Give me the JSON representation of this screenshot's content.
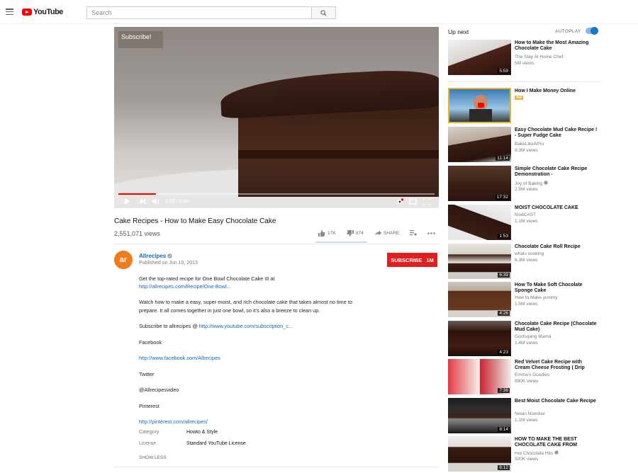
{
  "masthead": {
    "logo_text": "YouTube",
    "search_placeholder": "Search"
  },
  "player": {
    "overlay_text": "Subscribe!",
    "time": "0:20 / 2:48",
    "progress_fraction": 0.119
  },
  "video": {
    "title": "Cake Recipes - How to Make Easy Chocolate Cake",
    "views": "2,551,071 views",
    "likes": "17K",
    "dislikes": "874",
    "share_label": "SHARE"
  },
  "channel": {
    "avatar_text": "ar",
    "name": "Allrecipes",
    "published": "Published on Jun 10, 2013",
    "subscribe_label": "SUBSCRIBE",
    "subscriber_count": "1M"
  },
  "description": {
    "line1": "Get the top-rated recipe for One Bowl Chocolate Cake III at",
    "link1": "http://allrecipes.com/Recipe/One-Bowl...",
    "line2": "Watch how to make a easy, super-moist, and rich chocolate cake that takes almost no time to",
    "line3": "prepare. It all comes together in just one bowl, so it's also a breeze to clean up.",
    "subscribe_prefix": "Subscribe to allrecipes @ ",
    "subscribe_link": "http://www.youtube.com/subscription_c...",
    "facebook_label": "Facebook",
    "facebook_link": "http://www.facebook.com/Allrecipes",
    "twitter_label": "Twitter",
    "twitter_handle": "@Allrecipesvideo",
    "pinterest_label": "Pinterest",
    "pinterest_link": "http://pinterest.com/allrecipes/",
    "category_label": "Category",
    "category_value": "Howto & Style",
    "license_label": "License",
    "license_value": "Standard YouTube License",
    "show_less": "SHOW LESS"
  },
  "sidebar": {
    "up_next": "Up next",
    "autoplay": "AUTOPLAY",
    "items": [
      {
        "title": "How to Make the Most Amazing Chocolate Cake",
        "channel": "The Stay At Home Chef",
        "views": "5M views",
        "duration": "5:59"
      },
      {
        "title": "How I Make Money Online",
        "ad": "Ad"
      },
      {
        "title": "Easy Chocolate Mud Cake Recipe ! - Super Fudge Cake",
        "channel": "BakeLikeAPro",
        "views": "8.3M views",
        "duration": "11:14"
      },
      {
        "title": "Simple Chocolate Cake Recipe Demonstration -",
        "channel": "Joy of Baking",
        "views": "2.5M views",
        "duration": "17:32"
      },
      {
        "title": "MOIST CHOCOLATE CAKE",
        "channel": "foodCAST",
        "views": "1.1M views",
        "duration": "1:53"
      },
      {
        "title": "Chocolate Cake Roll Recipe",
        "channel": "whats cooking",
        "views": "6.3M views",
        "duration": "6:39"
      },
      {
        "title": "How To Make Soft Chocolate Sponge Cake",
        "channel": "How to Make yummy",
        "views": "1.5M views",
        "duration": "4:26"
      },
      {
        "title": "Chocolate Cake Recipe (Chocolate Mud Cake)",
        "channel": "Gochujang Mamá",
        "views": "1.4M views",
        "duration": "4:23"
      },
      {
        "title": "Red Velvet Cake Recipe with Cream Cheese Frosting ( Drip",
        "channel": "Emma's Goodies",
        "views": "890K views",
        "duration": "7:36"
      },
      {
        "title": "Best Moist Chocolate Cake Recipe",
        "channel": "Nolan Noecker",
        "views": "1.1M views",
        "duration": "8:14"
      },
      {
        "title": "HOW TO MAKE THE BEST CHOCOLATE CAKE FROM",
        "channel": "Hot Chocolate Hits",
        "views": "500K views",
        "duration": "6:12"
      }
    ]
  },
  "colors": {
    "brand_red": "#ff0000",
    "subscribe_red": "#e02020",
    "link_blue": "#1a63b8",
    "toggle_blue": "#167ac6",
    "ad_yellow": "#e6b432"
  }
}
